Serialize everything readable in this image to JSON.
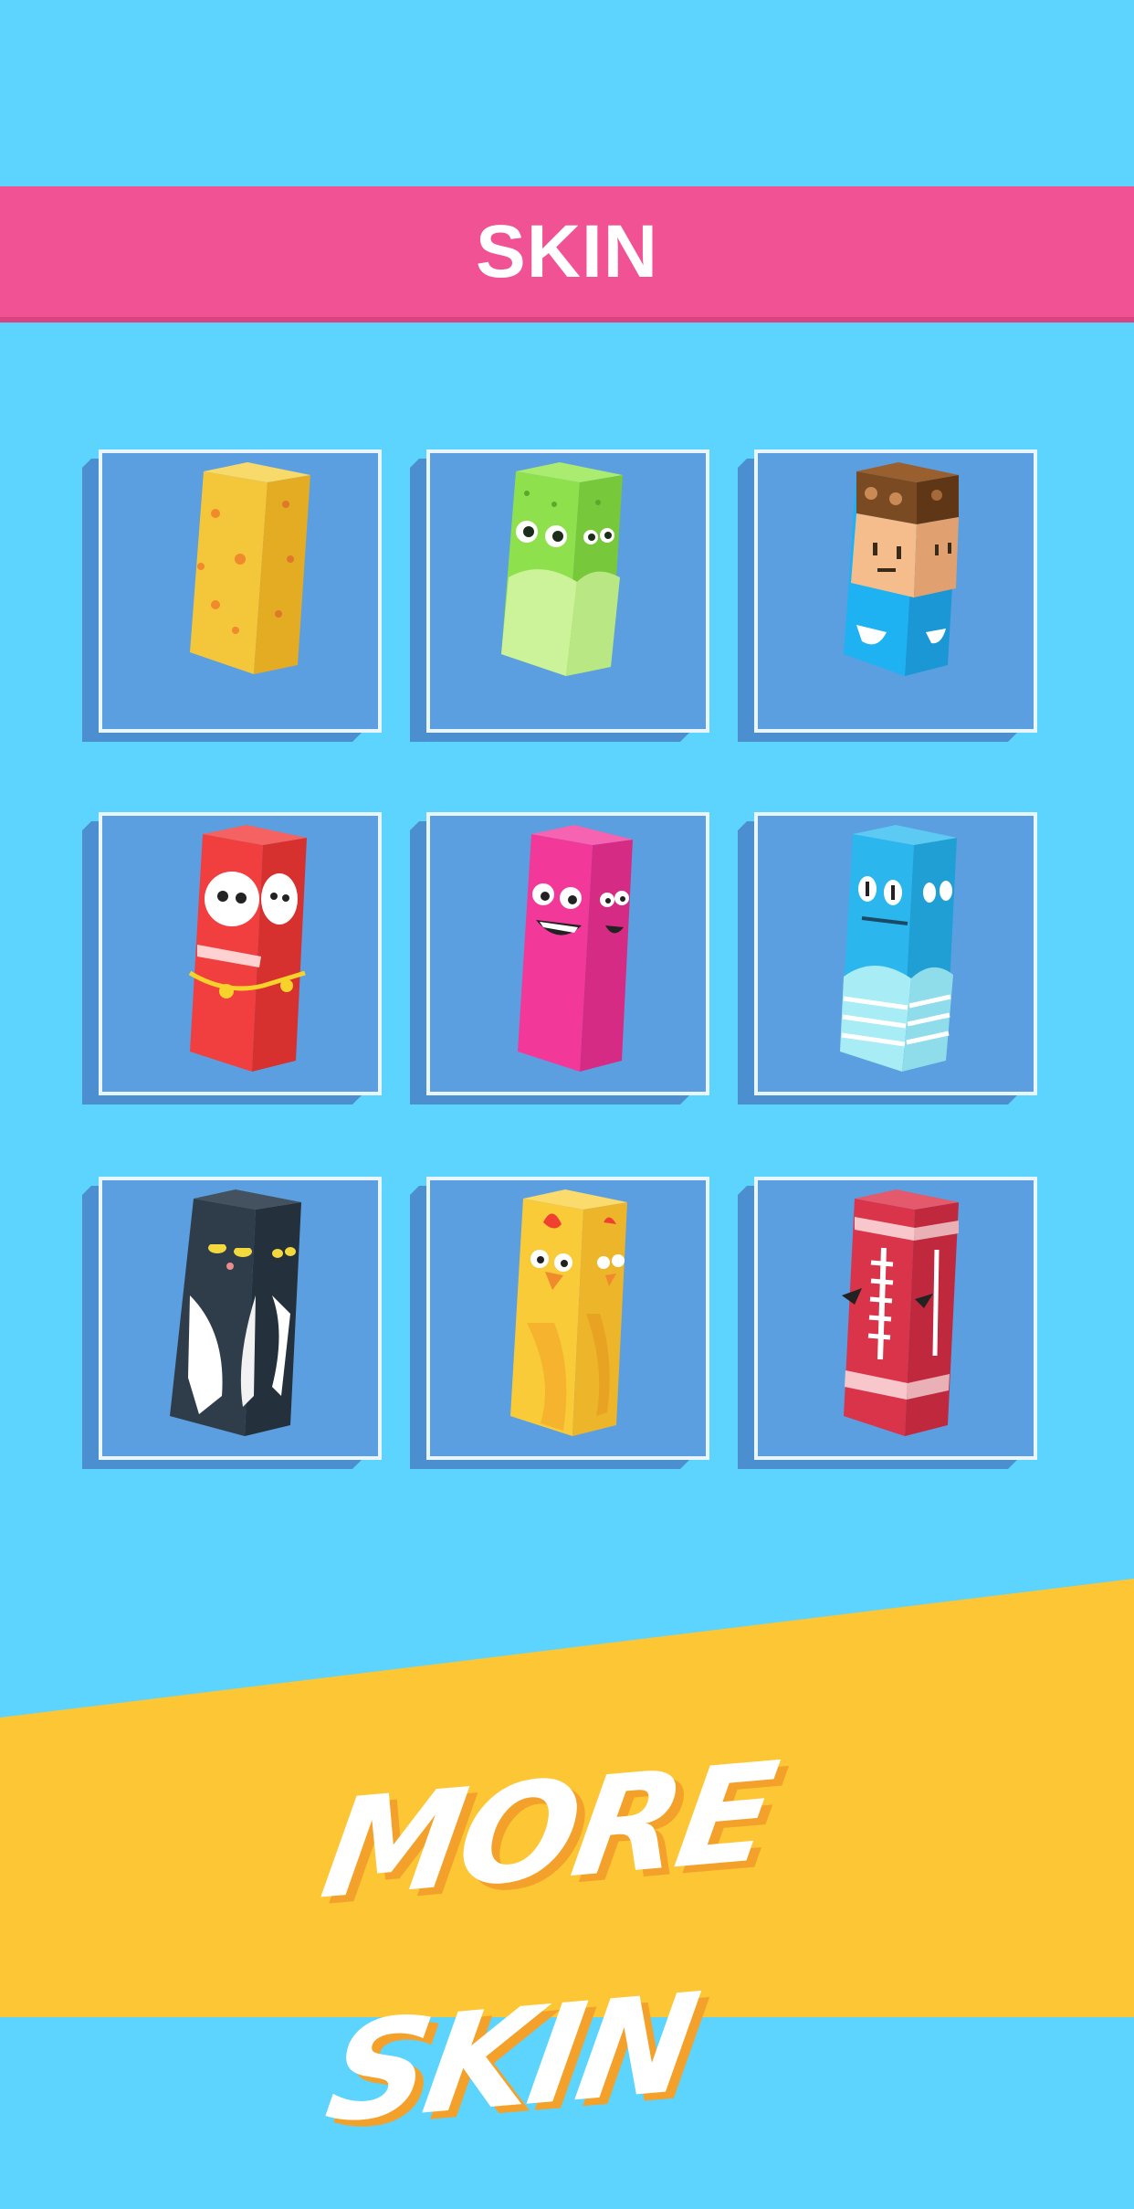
{
  "header": {
    "title": "SKIN"
  },
  "skins": [
    {
      "name": "cheese-skin",
      "color": "#f4c63a"
    },
    {
      "name": "green-frog-skin",
      "color": "#8ee04c"
    },
    {
      "name": "boy-skin",
      "color": "#1fb2f3"
    },
    {
      "name": "daruma-skin",
      "color": "#f13f3f"
    },
    {
      "name": "pink-monster-skin",
      "color": "#f2399a"
    },
    {
      "name": "blue-monster-skin",
      "color": "#2bb7ee"
    },
    {
      "name": "black-cat-skin",
      "color": "#2f3d4b"
    },
    {
      "name": "chick-skin",
      "color": "#f9cb39"
    },
    {
      "name": "football-skin",
      "color": "#d9344a"
    }
  ],
  "footer": {
    "more_label": "MORE SKIN",
    "accent": "#fdc634"
  },
  "colors": {
    "background": "#5dd4fd",
    "banner": "#f15293",
    "card": "#5b9fe0"
  }
}
